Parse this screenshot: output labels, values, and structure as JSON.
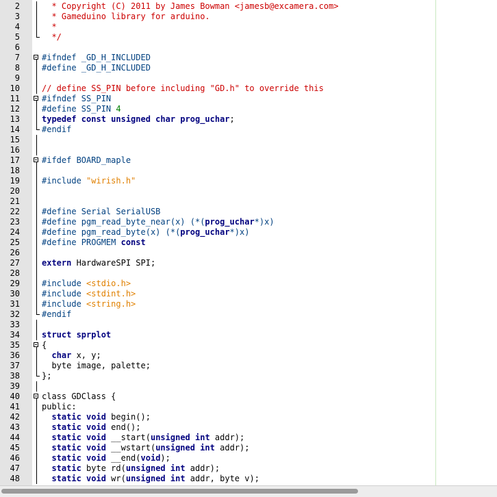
{
  "editor": {
    "lines": [
      {
        "n": "2",
        "tokens": [
          [
            "comment",
            "  * Copyright (C) 2011 by James Bowman <jamesb@excamera.com>"
          ]
        ]
      },
      {
        "n": "3",
        "tokens": [
          [
            "comment",
            "  * Gameduino library for arduino."
          ]
        ]
      },
      {
        "n": "4",
        "tokens": [
          [
            "comment",
            "  *"
          ]
        ]
      },
      {
        "n": "5",
        "tokens": [
          [
            "comment",
            "  */"
          ]
        ]
      },
      {
        "n": "6",
        "tokens": []
      },
      {
        "n": "7",
        "tokens": [
          [
            "pre",
            "#ifndef _GD_H_INCLUDED"
          ]
        ]
      },
      {
        "n": "8",
        "tokens": [
          [
            "pre",
            "#define _GD_H_INCLUDED"
          ]
        ]
      },
      {
        "n": "9",
        "tokens": []
      },
      {
        "n": "10",
        "tokens": [
          [
            "comment",
            "// define SS_PIN before including \"GD.h\" to override this"
          ]
        ]
      },
      {
        "n": "11",
        "tokens": [
          [
            "pre",
            "#ifndef SS_PIN"
          ]
        ]
      },
      {
        "n": "12",
        "tokens": [
          [
            "pre",
            "#define SS_PIN "
          ],
          [
            "num",
            "4"
          ]
        ]
      },
      {
        "n": "13",
        "tokens": [
          [
            "kw",
            "typedef const unsigned char prog_uchar"
          ],
          [
            "plain",
            ";"
          ]
        ]
      },
      {
        "n": "14",
        "tokens": [
          [
            "pre",
            "#endif"
          ]
        ]
      },
      {
        "n": "15",
        "tokens": []
      },
      {
        "n": "16",
        "tokens": []
      },
      {
        "n": "17",
        "tokens": [
          [
            "pre",
            "#ifdef BOARD_maple"
          ]
        ]
      },
      {
        "n": "18",
        "tokens": []
      },
      {
        "n": "19",
        "tokens": [
          [
            "pre",
            "#include "
          ],
          [
            "str",
            "\"wirish.h\""
          ]
        ]
      },
      {
        "n": "20",
        "tokens": []
      },
      {
        "n": "21",
        "tokens": []
      },
      {
        "n": "22",
        "tokens": [
          [
            "pre",
            "#define Serial SerialUSB"
          ]
        ]
      },
      {
        "n": "23",
        "tokens": [
          [
            "pre",
            "#define pgm_read_byte_near(x) (*("
          ],
          [
            "kw",
            "prog_uchar"
          ],
          [
            "pre",
            "*)x)"
          ]
        ]
      },
      {
        "n": "24",
        "tokens": [
          [
            "pre",
            "#define pgm_read_byte(x) (*("
          ],
          [
            "kw",
            "prog_uchar"
          ],
          [
            "pre",
            "*)x)"
          ]
        ]
      },
      {
        "n": "25",
        "tokens": [
          [
            "pre",
            "#define PROGMEM "
          ],
          [
            "kw",
            "const"
          ]
        ]
      },
      {
        "n": "26",
        "tokens": []
      },
      {
        "n": "27",
        "tokens": [
          [
            "kw",
            "extern "
          ],
          [
            "plain",
            "HardwareSPI SPI;"
          ]
        ]
      },
      {
        "n": "28",
        "tokens": []
      },
      {
        "n": "29",
        "tokens": [
          [
            "pre",
            "#include "
          ],
          [
            "str",
            "<stdio.h>"
          ]
        ]
      },
      {
        "n": "30",
        "tokens": [
          [
            "pre",
            "#include "
          ],
          [
            "str",
            "<stdint.h>"
          ]
        ]
      },
      {
        "n": "31",
        "tokens": [
          [
            "pre",
            "#include "
          ],
          [
            "str",
            "<string.h>"
          ]
        ]
      },
      {
        "n": "32",
        "tokens": [
          [
            "pre",
            "#endif"
          ]
        ]
      },
      {
        "n": "33",
        "tokens": []
      },
      {
        "n": "34",
        "tokens": [
          [
            "kw",
            "struct sprplot"
          ]
        ]
      },
      {
        "n": "35",
        "tokens": [
          [
            "plain",
            "{"
          ]
        ]
      },
      {
        "n": "36",
        "tokens": [
          [
            "plain",
            "  "
          ],
          [
            "kw",
            "char"
          ],
          [
            "plain",
            " x, y;"
          ]
        ]
      },
      {
        "n": "37",
        "tokens": [
          [
            "plain",
            "  byte image, palette;"
          ]
        ]
      },
      {
        "n": "38",
        "tokens": [
          [
            "plain",
            "};"
          ]
        ]
      },
      {
        "n": "39",
        "tokens": []
      },
      {
        "n": "40",
        "tokens": [
          [
            "plain",
            "class GDClass {"
          ]
        ]
      },
      {
        "n": "41",
        "tokens": [
          [
            "plain",
            "public:"
          ]
        ]
      },
      {
        "n": "42",
        "tokens": [
          [
            "plain",
            "  "
          ],
          [
            "kw",
            "static void"
          ],
          [
            "plain",
            " begin();"
          ]
        ]
      },
      {
        "n": "43",
        "tokens": [
          [
            "plain",
            "  "
          ],
          [
            "kw",
            "static void"
          ],
          [
            "plain",
            " end();"
          ]
        ]
      },
      {
        "n": "44",
        "tokens": [
          [
            "plain",
            "  "
          ],
          [
            "kw",
            "static void"
          ],
          [
            "plain",
            " __start("
          ],
          [
            "kw",
            "unsigned int"
          ],
          [
            "plain",
            " addr);"
          ]
        ]
      },
      {
        "n": "45",
        "tokens": [
          [
            "plain",
            "  "
          ],
          [
            "kw",
            "static void"
          ],
          [
            "plain",
            " __wstart("
          ],
          [
            "kw",
            "unsigned int"
          ],
          [
            "plain",
            " addr);"
          ]
        ]
      },
      {
        "n": "46",
        "tokens": [
          [
            "plain",
            "  "
          ],
          [
            "kw",
            "static void"
          ],
          [
            "plain",
            " __end("
          ],
          [
            "kw",
            "void"
          ],
          [
            "plain",
            ");"
          ]
        ]
      },
      {
        "n": "47",
        "tokens": [
          [
            "plain",
            "  "
          ],
          [
            "kw",
            "static"
          ],
          [
            "plain",
            " byte rd("
          ],
          [
            "kw",
            "unsigned int"
          ],
          [
            "plain",
            " addr);"
          ]
        ]
      },
      {
        "n": "48",
        "tokens": [
          [
            "plain",
            "  "
          ],
          [
            "kw",
            "static void"
          ],
          [
            "plain",
            " wr("
          ],
          [
            "kw",
            "unsigned int"
          ],
          [
            "plain",
            " addr, byte v);"
          ]
        ]
      }
    ],
    "fold_markers": {
      "2": "line",
      "3": "line",
      "4": "line",
      "5": "end",
      "7": "open",
      "8": "line",
      "9": "line",
      "10": "line",
      "11": "open",
      "12": "line",
      "13": "line",
      "14": "end",
      "15": "line",
      "16": "line",
      "17": "open",
      "18": "line",
      "19": "line",
      "20": "line",
      "21": "line",
      "22": "line",
      "23": "line",
      "24": "line",
      "25": "line",
      "26": "line",
      "27": "line",
      "28": "line",
      "29": "line",
      "30": "line",
      "31": "line",
      "32": "end",
      "33": "line",
      "34": "line",
      "35": "open",
      "36": "line",
      "37": "line",
      "38": "end",
      "39": "line",
      "40": "open",
      "41": "line",
      "42": "line",
      "43": "line",
      "44": "line",
      "45": "line",
      "46": "line",
      "47": "line",
      "48": "line"
    }
  },
  "colors": {
    "comment": "#cc0000",
    "preprocessor": "#004080",
    "keyword": "#00007f",
    "string": "#e08000",
    "number": "#007f00",
    "gutter": "#e4e4e4"
  }
}
